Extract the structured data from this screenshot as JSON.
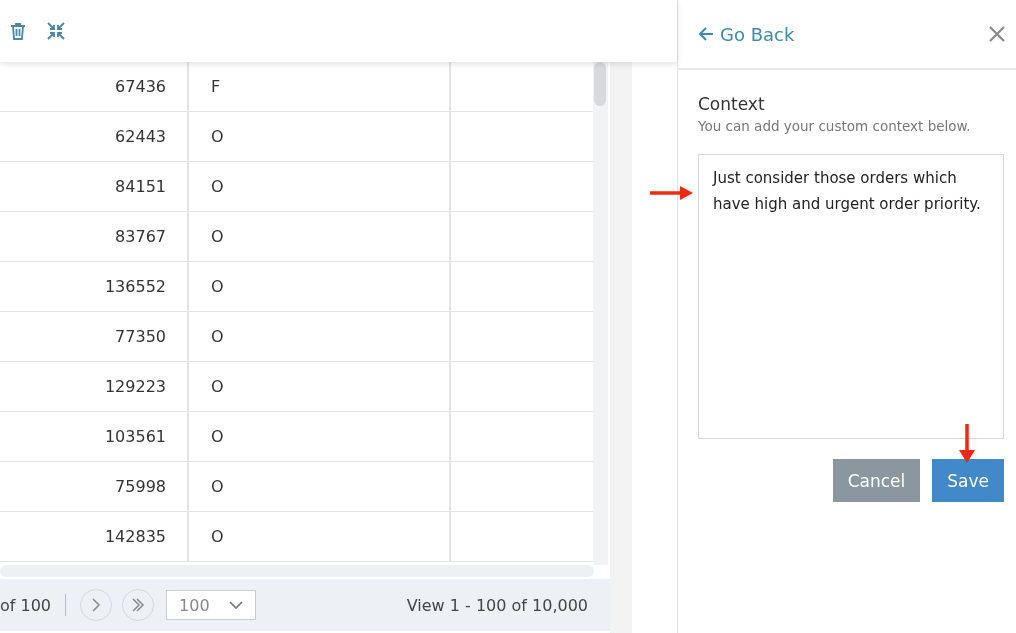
{
  "table": {
    "rows": [
      {
        "column_1": "67436",
        "column_2": "F"
      },
      {
        "column_1": "62443",
        "column_2": "O"
      },
      {
        "column_1": "84151",
        "column_2": "O"
      },
      {
        "column_1": "83767",
        "column_2": "O"
      },
      {
        "column_1": "136552",
        "column_2": "O"
      },
      {
        "column_1": "77350",
        "column_2": "O"
      },
      {
        "column_1": "129223",
        "column_2": "O"
      },
      {
        "column_1": "103561",
        "column_2": "O"
      },
      {
        "column_1": "75998",
        "column_2": "O"
      },
      {
        "column_1": "142835",
        "column_2": "O"
      }
    ]
  },
  "pager": {
    "page_total": "of 100",
    "page_size": "100",
    "summary": "View 1 - 100 of 10,000"
  },
  "panel": {
    "back_label": "Go Back",
    "title": "Context",
    "subtitle": "You can add your custom context below.",
    "context_text": "Just consider those orders which have high and urgent order priority.",
    "buttons": [
      {
        "label": "Cancel",
        "kind": "secondary"
      },
      {
        "label": "Save",
        "kind": "primary"
      }
    ]
  }
}
